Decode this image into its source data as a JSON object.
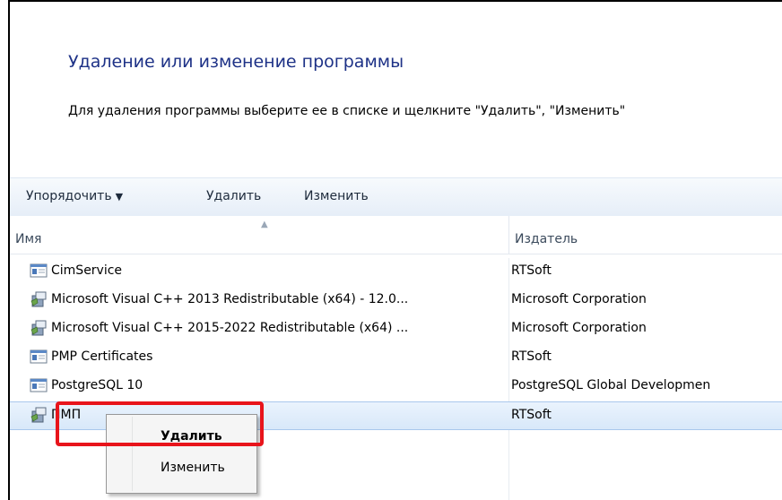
{
  "page": {
    "title": "Удаление или изменение программы",
    "subtitle": "Для удаления программы выберите ее в списке и щелкните \"Удалить\", \"Изменить\""
  },
  "toolbar": {
    "organize_label": "Упорядочить",
    "uninstall_label": "Удалить",
    "change_label": "Изменить"
  },
  "columns": {
    "name": "Имя",
    "publisher": "Издатель"
  },
  "programs": [
    {
      "name": "CimService",
      "publisher": "RTSoft",
      "icon": "application-icon"
    },
    {
      "name": "Microsoft Visual C++ 2013 Redistributable (x64) - 12.0...",
      "publisher": "Microsoft Corporation",
      "icon": "installer-icon"
    },
    {
      "name": "Microsoft Visual C++ 2015-2022 Redistributable (x64) ...",
      "publisher": "Microsoft Corporation",
      "icon": "installer-icon"
    },
    {
      "name": "PMP Certificates",
      "publisher": "RTSoft",
      "icon": "application-icon"
    },
    {
      "name": "PostgreSQL 10",
      "publisher": "PostgreSQL Global Developmen",
      "icon": "application-icon"
    },
    {
      "name": "ПМП",
      "publisher": "RTSoft",
      "icon": "installer-icon",
      "selected": true
    }
  ],
  "context_menu": {
    "uninstall_label": "Удалить",
    "change_label": "Изменить"
  },
  "colors": {
    "title": "#1e3287",
    "highlight": "#e8141b",
    "selection": "#d8e8f9"
  }
}
